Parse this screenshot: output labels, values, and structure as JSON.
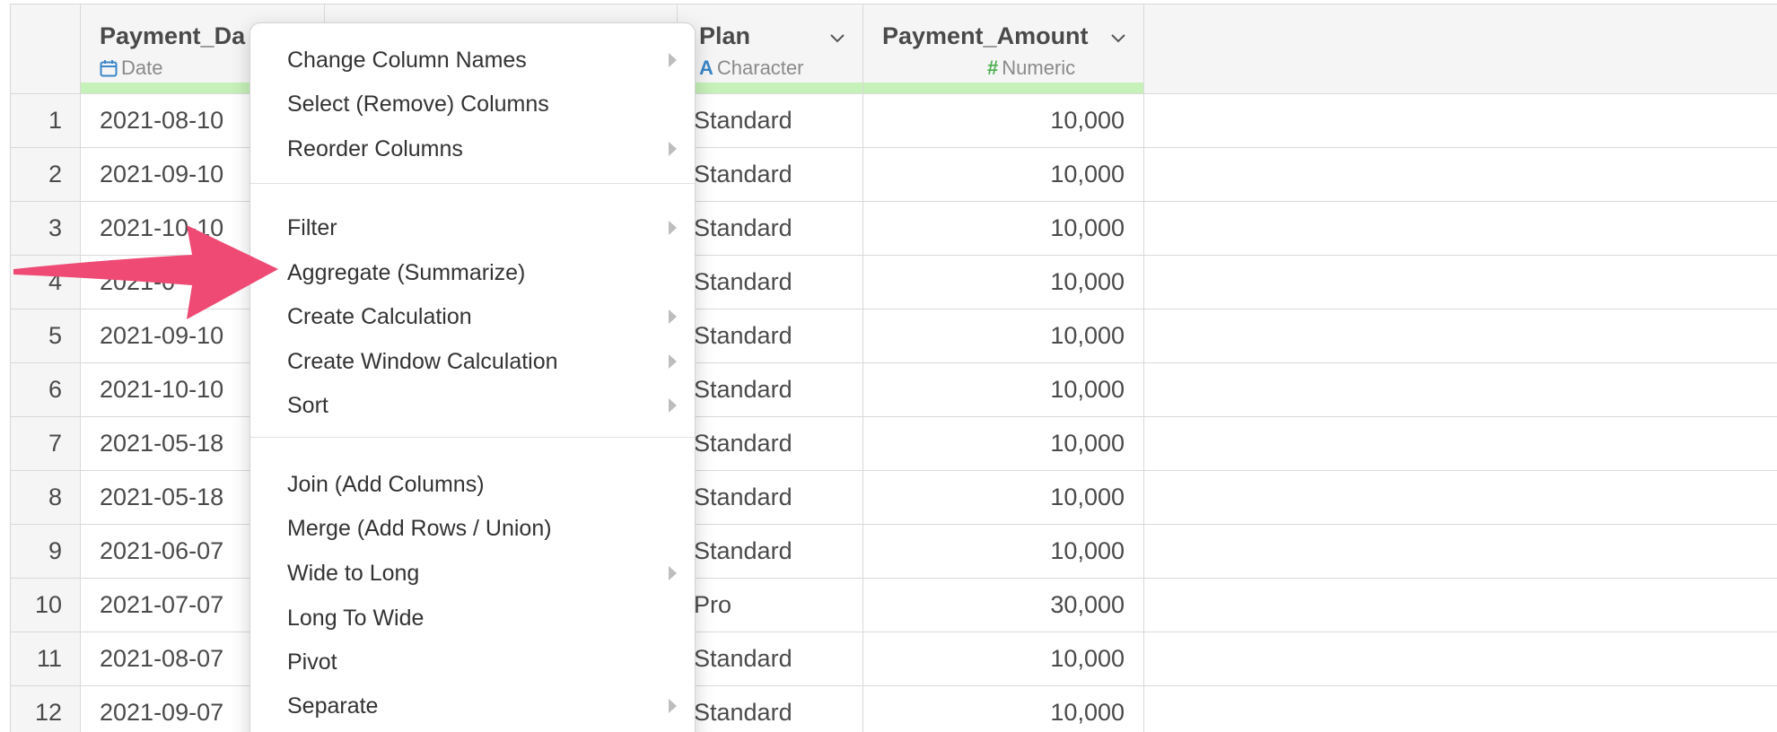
{
  "columns": [
    {
      "name": "Payment_Da",
      "type": "Date",
      "icon": "calendar-icon"
    },
    {
      "name": "Plan",
      "type": "Character",
      "icon": "character-type-icon"
    },
    {
      "name": "Payment_Amount",
      "type": "Numeric",
      "icon": "hash-icon"
    }
  ],
  "rows": [
    {
      "idx": "1",
      "date": "2021-08-10",
      "plan": "Standard",
      "amount": "10,000"
    },
    {
      "idx": "2",
      "date": "2021-09-10",
      "plan": "Standard",
      "amount": "10,000"
    },
    {
      "idx": "3",
      "date": "2021-10-10",
      "plan": "Standard",
      "amount": "10,000"
    },
    {
      "idx": "4",
      "date": "2021-0",
      "plan": "Standard",
      "amount": "10,000"
    },
    {
      "idx": "5",
      "date": "2021-09-10",
      "plan": "Standard",
      "amount": "10,000"
    },
    {
      "idx": "6",
      "date": "2021-10-10",
      "plan": "Standard",
      "amount": "10,000"
    },
    {
      "idx": "7",
      "date": "2021-05-18",
      "plan": "Standard",
      "amount": "10,000"
    },
    {
      "idx": "8",
      "date": "2021-05-18",
      "plan": "Standard",
      "amount": "10,000"
    },
    {
      "idx": "9",
      "date": "2021-06-07",
      "plan": "Standard",
      "amount": "10,000"
    },
    {
      "idx": "10",
      "date": "2021-07-07",
      "plan": "Pro",
      "amount": "30,000"
    },
    {
      "idx": "11",
      "date": "2021-08-07",
      "plan": "Standard",
      "amount": "10,000"
    },
    {
      "idx": "12",
      "date": "2021-09-07",
      "plan": "Standard",
      "amount": "10,000"
    }
  ],
  "menu": {
    "items": [
      {
        "label": "Change Column Names",
        "submenu": true
      },
      {
        "label": "Select (Remove) Columns",
        "submenu": false
      },
      {
        "label": "Reorder Columns",
        "submenu": true
      },
      {
        "label": "Filter",
        "submenu": true
      },
      {
        "label": "Aggregate (Summarize)",
        "submenu": false
      },
      {
        "label": "Create Calculation",
        "submenu": true
      },
      {
        "label": "Create Window Calculation",
        "submenu": true
      },
      {
        "label": "Sort",
        "submenu": true
      },
      {
        "label": "Join (Add Columns)",
        "submenu": false
      },
      {
        "label": "Merge (Add Rows / Union)",
        "submenu": false
      },
      {
        "label": "Wide to Long",
        "submenu": true
      },
      {
        "label": "Long To Wide",
        "submenu": false
      },
      {
        "label": "Pivot",
        "submenu": false
      },
      {
        "label": "Separate",
        "submenu": true
      }
    ]
  },
  "colors": {
    "accent_green": "#c6f1b8",
    "date_icon": "#3a86c8",
    "numeric_icon": "#4caf50",
    "arrow": "#ee4a74"
  }
}
